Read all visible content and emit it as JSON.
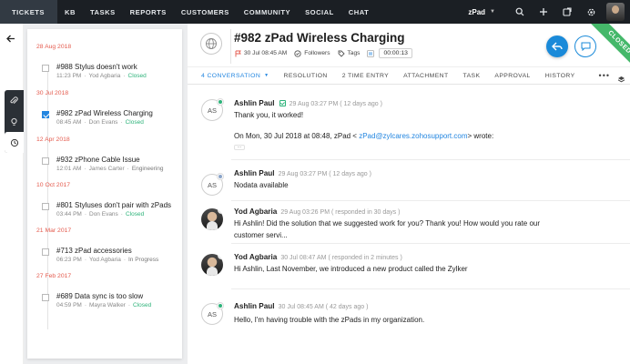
{
  "nav": {
    "items": [
      "TICKETS",
      "KB",
      "TASKS",
      "REPORTS",
      "CUSTOMERS",
      "COMMUNITY",
      "SOCIAL",
      "CHAT"
    ],
    "brand": "zPad",
    "icons": [
      "search-icon",
      "plus-icon",
      "external-window-icon",
      "gear-icon",
      "profile-avatar"
    ]
  },
  "history": {
    "groups": [
      {
        "date": "28 Aug 2018",
        "title": "#988 Stylus doesn't work",
        "time": "11:23 PM",
        "person": "Yod Agbaria",
        "status": "Closed",
        "checked": false
      },
      {
        "date": "30 Jul 2018",
        "title": "#982 zPad Wireless Charging",
        "time": "08:45 AM",
        "person": "Don Evans",
        "status": "Closed",
        "checked": true
      },
      {
        "date": "12 Apr 2018",
        "title": "#932 zPhone Cable Issue",
        "time": "12:01 AM",
        "person": "James Carter",
        "status": "Engineering",
        "checked": false
      },
      {
        "date": "10 Oct 2017",
        "title": "#801 Styluses don't pair with zPads",
        "time": "03:44 PM",
        "person": "Don Evans",
        "status": "Closed",
        "checked": false
      },
      {
        "date": "21 Mar 2017",
        "title": "#713 zPad accessories",
        "time": "06:23 PM",
        "person": "Yod Agbaria",
        "status": "In Progress",
        "checked": false
      },
      {
        "date": "27 Feb 2017",
        "title": "#689 Data sync is too slow",
        "time": "04:59 PM",
        "person": "Mayra Walker",
        "status": "Closed",
        "checked": false
      }
    ]
  },
  "ticket": {
    "title": "#982  zPad Wireless Charging",
    "datetime": "30 Jul 08:45 AM",
    "followers_label": "Followers",
    "tags_label": "Tags",
    "timer": "00:00:13",
    "status_ribbon": "CLOSED",
    "colors": {
      "accent": "#1a8ad9",
      "ribbon": "#45b86a",
      "date": "#e45a4d",
      "closed": "#2db37a"
    }
  },
  "tabs": [
    "4  CONVERSATION",
    "RESOLUTION",
    "2 TIME ENTRY",
    "ATTACHMENT",
    "TASK",
    "APPROVAL",
    "HISTORY"
  ],
  "conversation": [
    {
      "initials": "AS",
      "photo": false,
      "badge_color": "#2db37a",
      "author": "Ashlin Paul",
      "verified": true,
      "stamp": "29 Aug 03:27 PM ( 12 days ago )",
      "lines": [
        "Thank you, it worked!"
      ],
      "quote_prefix": "On Mon, 30 Jul 2018 at 08:48, zPad < ",
      "quote_email": "zPad@zylcares.zohosupport.com",
      "quote_suffix": "> wrote:",
      "quote_more": "..."
    },
    {
      "initials": "AS",
      "photo": false,
      "badge_color": "#8aa4c8",
      "author": "Ashlin Paul",
      "verified": false,
      "stamp": "29 Aug 03:27 PM ( 12 days ago )",
      "lines": [
        "Nodata available"
      ]
    },
    {
      "initials": "",
      "photo": true,
      "badge_color": "#2386e0",
      "author": "Yod Agbaria",
      "verified": false,
      "stamp": "29 Aug 03:26 PM ( responded in 30 days )",
      "lines": [
        "Hi Ashlin! Did the solution that we suggested work for you? Thank you! How would you rate our",
        "customer servi..."
      ]
    },
    {
      "initials": "",
      "photo": true,
      "badge_color": "#2386e0",
      "author": "Yod Agbaria",
      "verified": false,
      "stamp": "30 Jul 08:47 AM ( responded in 2 minutes )",
      "lines": [
        "Hi Ashlin, Last November, we introduced a new product called the Zylker"
      ]
    },
    {
      "initials": "AS",
      "photo": false,
      "badge_color": "#2db37a",
      "author": "Ashlin Paul",
      "verified": false,
      "stamp": "30 Jul 08:45 AM ( 42 days ago )",
      "lines": [
        "Hello, I'm having trouble with the zPads in my organization."
      ]
    }
  ]
}
